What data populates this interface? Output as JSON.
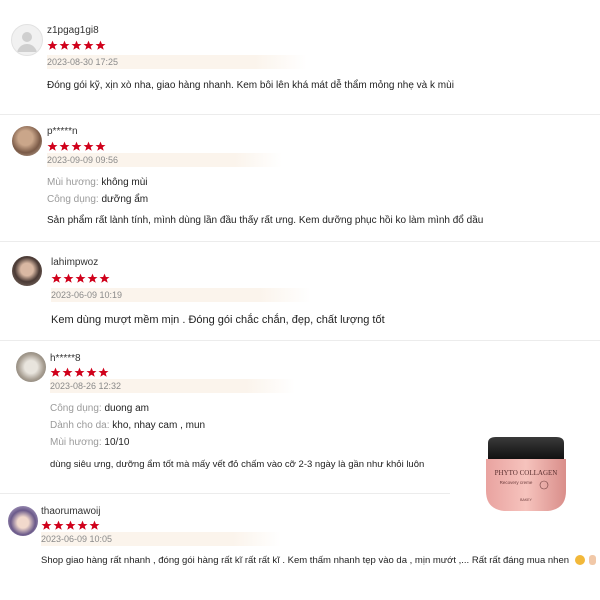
{
  "colors": {
    "star": "#d0011b",
    "accent": "#e83d60"
  },
  "reviews": [
    {
      "username": "z1pgag1gi8",
      "rating": 5,
      "date": "2023-08-30 17:25",
      "attributes": [],
      "text": "Đóng gói kỹ, xịn xò nha, giao hàng nhanh. Kem bôi lên khá mát dễ thẩm mỏng nhẹ và k mùi",
      "avatar": "default-avatar-icon"
    },
    {
      "username": "p*****n",
      "rating": 5,
      "date": "2023-09-09 09:56",
      "attributes": [
        {
          "key": "Mùi hương:",
          "value": "không mùi"
        },
        {
          "key": "Công dụng:",
          "value": "dưỡng ẩm"
        }
      ],
      "text": "Sản phẩm rất lành tính, mình dùng lần đầu thấy rất ưng. Kem dưỡng phục hồi ko làm mình đổ dầu",
      "avatar": "user-photo-avatar"
    },
    {
      "username": "lahimpwoz",
      "rating": 5,
      "date": "2023-06-09 10:19",
      "attributes": [],
      "text": "Kem dùng mượt mềm mịn . Đóng gói chắc chắn, đẹp, chất lượng tốt",
      "avatar": "user-photo-avatar"
    },
    {
      "username": "h*****8",
      "rating": 5,
      "date": "2023-08-26 12:32",
      "attributes": [
        {
          "key": "Công dụng:",
          "value": "duong am"
        },
        {
          "key": "Dành cho da:",
          "value": "kho, nhay cam , mun"
        },
        {
          "key": "Mùi hương:",
          "value": "10/10"
        }
      ],
      "text": "dùng siêu ưng, dưỡng ẩm tốt mà mấy vết đỏ chấm vào cỡ 2-3 ngày là gần như khỏi luôn",
      "avatar": "dog-photo-avatar"
    },
    {
      "username": "thaorumawoij",
      "rating": 5,
      "date": "2023-06-09 10:05",
      "attributes": [],
      "text": "Shop giao hàng rất nhanh , đóng gói hàng rất kĩ rất rất kĩ . Kem thấm nhanh tẹp vào da , mịn mướt ,... Rất rất đáng mua nhen",
      "avatar": "anime-avatar"
    }
  ],
  "product": {
    "brand": "PHYTO COLLAGEN",
    "subtitle": "Recovery creme",
    "maker": "BAKEY"
  }
}
